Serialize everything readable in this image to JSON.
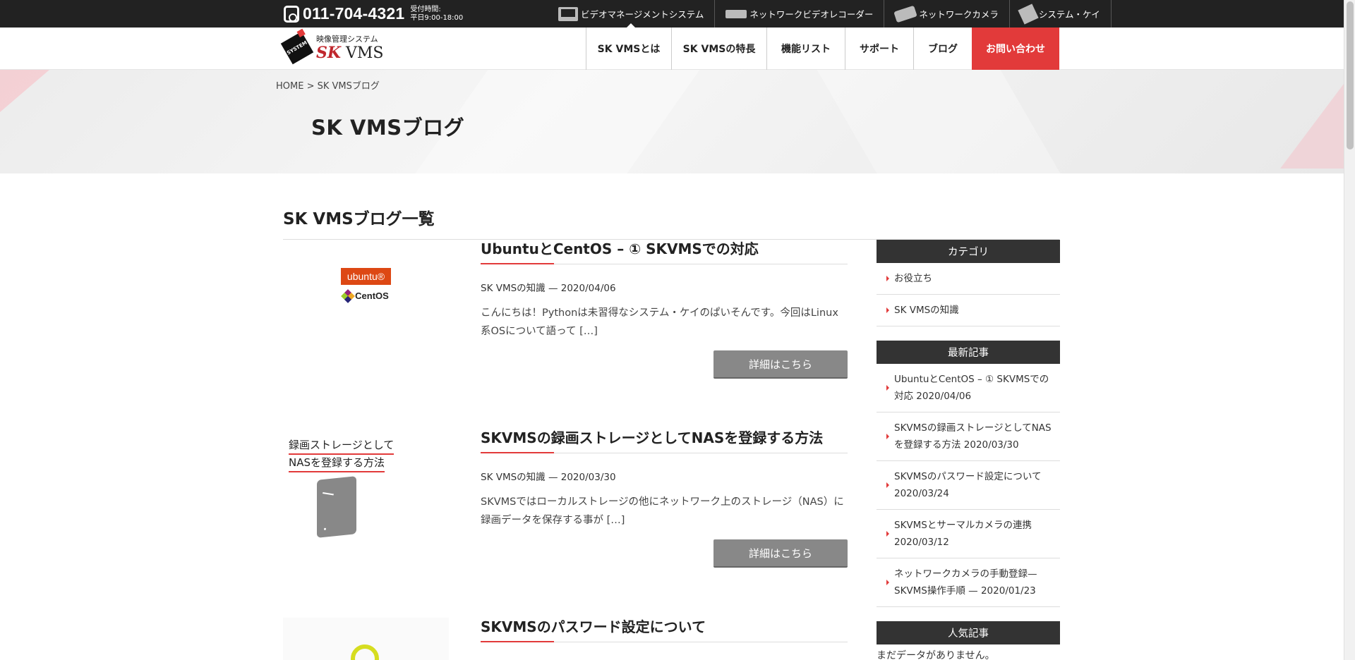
{
  "topbar": {
    "phone": "011-704-4321",
    "hours_label": "受付時間:",
    "hours_value": "平日9:00-18:00",
    "links": [
      {
        "label": "ビデオマネージメントシステム",
        "icon": "monitor-icon"
      },
      {
        "label": "ネットワークビデオレコーダー",
        "icon": "recorder-icon"
      },
      {
        "label": "ネットワークカメラ",
        "icon": "camera-icon"
      },
      {
        "label": "システム・ケイ",
        "icon": "company-box-icon"
      }
    ]
  },
  "header": {
    "logo_badge": "SYSTEM",
    "logo_sub": "映像管理システム",
    "logo_brand_sk": "SK",
    "logo_brand_vms": " VMS",
    "nav": [
      {
        "label": "SK VMSとは"
      },
      {
        "label": "SK VMSの特長"
      },
      {
        "label": "機能リスト"
      },
      {
        "label": "サポート"
      },
      {
        "label": "ブログ"
      },
      {
        "label": "お問い合わせ"
      }
    ]
  },
  "hero": {
    "breadcrumb": "HOME > SK VMSブログ",
    "title": "SK VMSブログ"
  },
  "main": {
    "section_title": "SK VMSブログ一覧",
    "posts": [
      {
        "title": "UbuntuとCentOS – ① SKVMSでの対応",
        "meta": "SK VMSの知識 — 2020/04/06",
        "excerpt": "こんにちは！Pythonは未習得なシステム・ケイのぱいそんです。今回はLinux系OSについて語って […]",
        "button": "詳細はこちら",
        "thumb_ubuntu": "ubuntu®",
        "thumb_centos": "CentOS"
      },
      {
        "title": "SKVMSの録画ストレージとしてNASを登録する方法",
        "meta": "SK VMSの知識 — 2020/03/30",
        "excerpt": "SKVMSではローカルストレージの他にネットワーク上のストレージ（NAS）に録画データを保存する事が […]",
        "button": "詳細はこちら",
        "thumb_line1": "録画ストレージとして",
        "thumb_line2": "NASを登録する方法"
      },
      {
        "title": "SKVMSのパスワード設定について"
      }
    ]
  },
  "sidebar": {
    "categories_title": "カテゴリ",
    "categories": [
      {
        "label": "お役立ち"
      },
      {
        "label": "SK VMSの知識"
      }
    ],
    "recent_title": "最新記事",
    "recent": [
      {
        "label": "UbuntuとCentOS – ① SKVMSでの対応 2020/04/06"
      },
      {
        "label": "SKVMSの録画ストレージとしてNASを登録する方法 2020/03/30"
      },
      {
        "label": "SKVMSのパスワード設定について 2020/03/24"
      },
      {
        "label": "SKVMSとサーマルカメラの連携 2020/03/12"
      },
      {
        "label": "ネットワークカメラの手動登録—SKVMS操作手順 — 2020/01/23"
      }
    ],
    "popular_title": "人気記事",
    "popular_empty": "まだデータがありません。"
  },
  "colors": {
    "accent": "#e23a3a",
    "topbar": "#222222",
    "button": "#888888"
  }
}
